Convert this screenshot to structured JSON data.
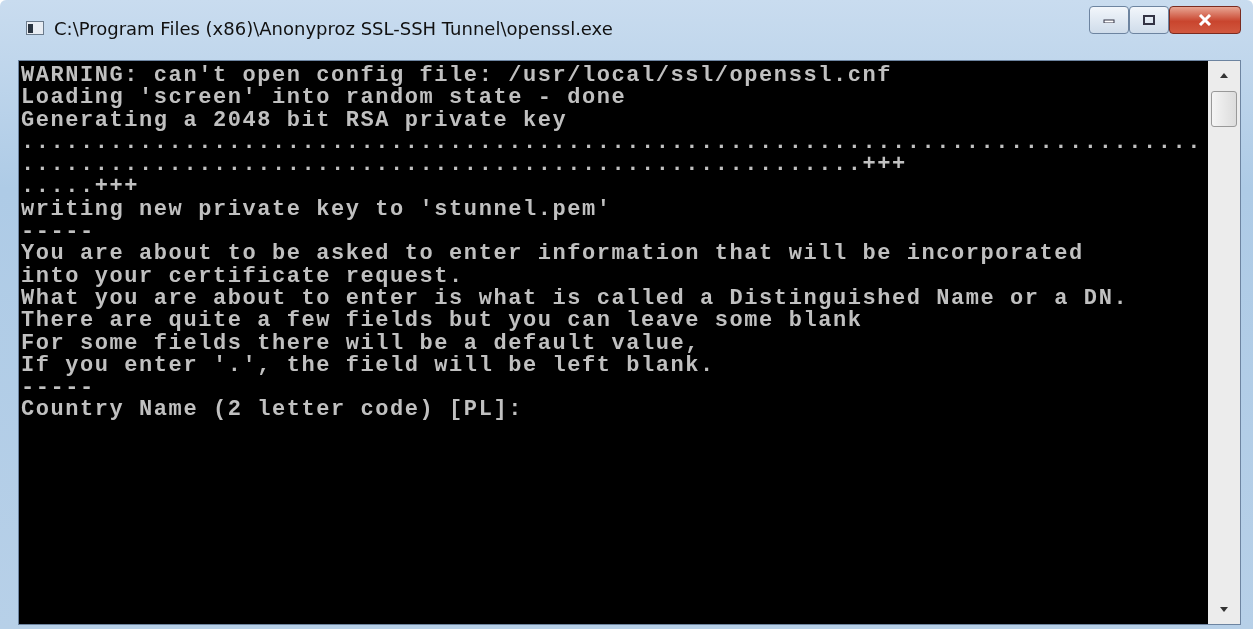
{
  "window": {
    "title": "C:\\Program Files (x86)\\Anonyproz SSL-SSH Tunnel\\openssl.exe"
  },
  "console": {
    "lines": [
      "WARNING: can't open config file: /usr/local/ssl/openssl.cnf",
      "Loading 'screen' into random state - done",
      "Generating a 2048 bit RSA private key",
      "................................................................................",
      ".........................................................+++",
      ".....+++",
      "writing new private key to 'stunnel.pem'",
      "-----",
      "You are about to be asked to enter information that will be incorporated",
      "into your certificate request.",
      "What you are about to enter is what is called a Distinguished Name or a DN.",
      "There are quite a few fields but you can leave some blank",
      "For some fields there will be a default value,",
      "If you enter '.', the field will be left blank.",
      "-----",
      "Country Name (2 letter code) [PL]:"
    ]
  }
}
